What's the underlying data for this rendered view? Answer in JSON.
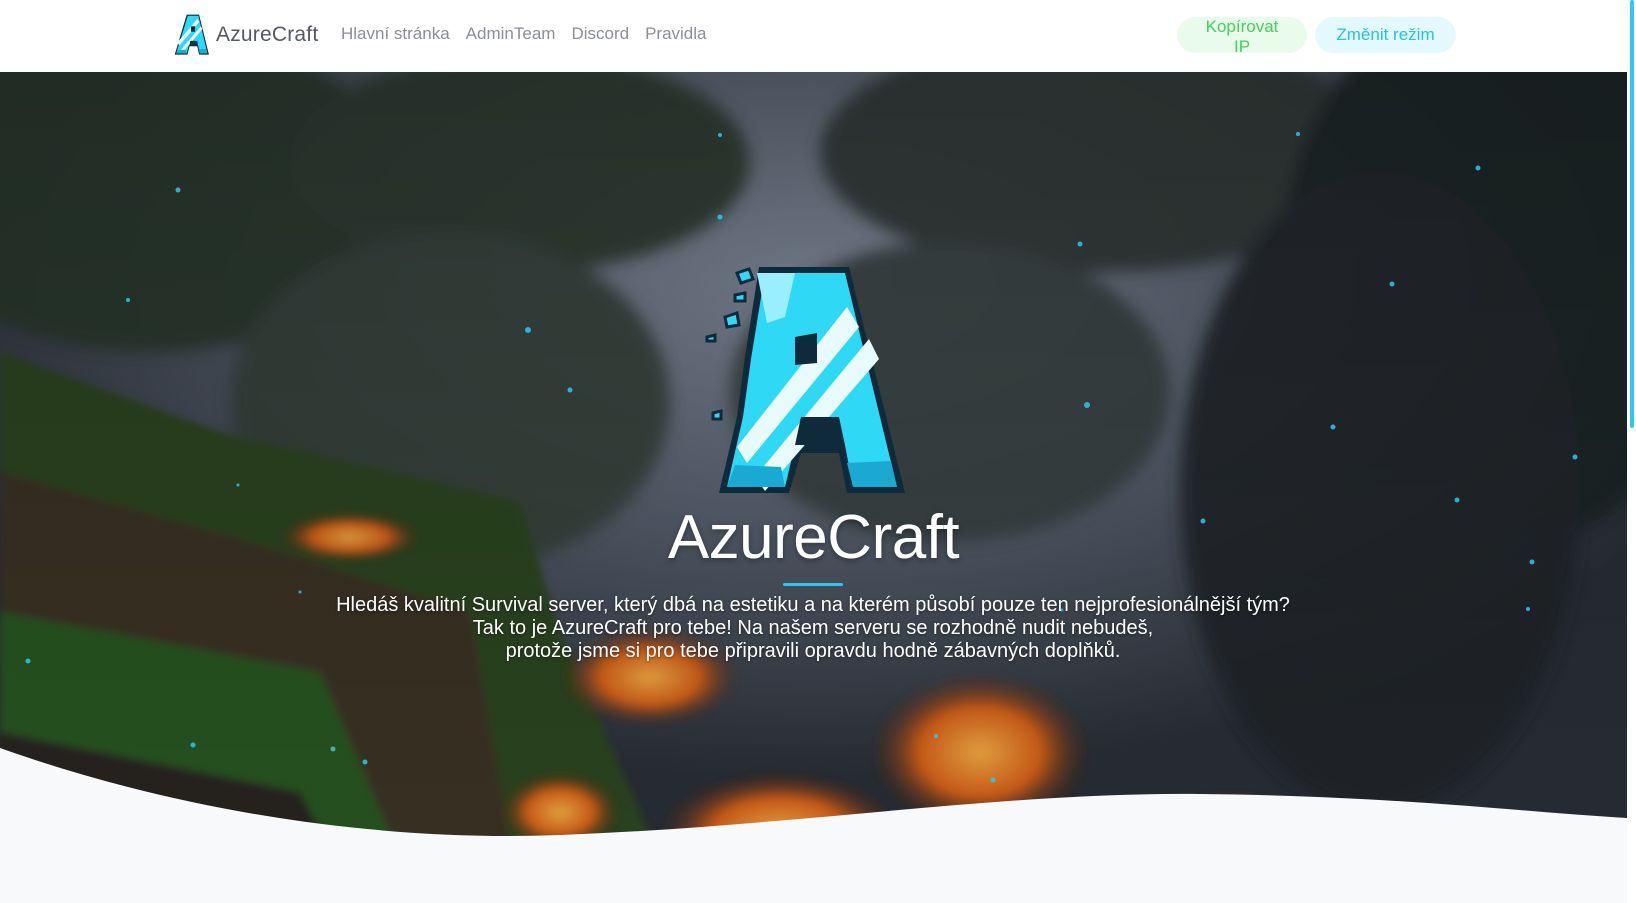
{
  "navbar": {
    "brand": "AzureCraft",
    "links": [
      "Hlavní stránka",
      "AdminTeam",
      "Discord",
      "Pravidla"
    ],
    "copy_ip_label": "Kopírovat IP",
    "change_mode_label": "Změnit režim"
  },
  "hero": {
    "title": "AzureCraft",
    "lines": [
      "Hledáš kvalitní Survival server, který dbá na estetiku a na kterém působí pouze ten nejprofesionálnější tým?",
      "Tak to je AzureCraft pro tebe! Na našem serveru se rozhodně nudit nebudeš,",
      "protože jsme si pro tebe připravili opravdu hodně zábavných doplňků."
    ]
  },
  "colors": {
    "accent": "#2cc9ee",
    "copy_ip_text": "#3fd35a",
    "copy_ip_bg": "#e9fbea",
    "mode_text": "#22c3e6",
    "mode_bg": "#e3f9fd"
  },
  "icons": {
    "brand_logo": "azurecraft-a-logo",
    "hero_logo": "azurecraft-a-logo"
  }
}
